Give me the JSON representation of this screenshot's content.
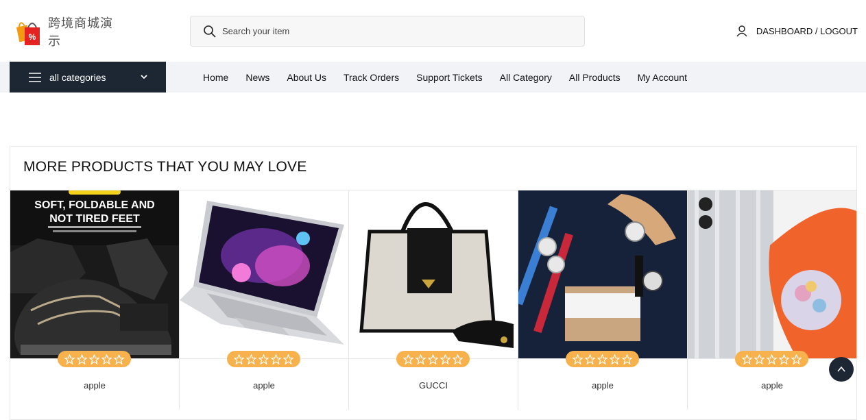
{
  "header": {
    "logo_text": "跨境商城演示",
    "logo_badge": "%",
    "search_placeholder": "Search your item",
    "account_label": "DASHBOARD / LOGOUT"
  },
  "nav": {
    "categories_label": "all categories",
    "items": [
      "Home",
      "News",
      "About Us",
      "Track Orders",
      "Support Tickets",
      "All Category",
      "All Products",
      "My Account"
    ]
  },
  "section": {
    "title": "MORE PRODUCTS THAT YOU MAY LOVE"
  },
  "products": [
    {
      "name": "apple",
      "image": "shoe",
      "banner_text_1": "SOFT, FOLDABLE AND",
      "banner_text_2": "NOT TIRED FEET",
      "rating": 0
    },
    {
      "name": "apple",
      "image": "laptop",
      "rating": 0
    },
    {
      "name": "GUCCI",
      "image": "handbag",
      "rating": 0
    },
    {
      "name": "apple",
      "image": "watches",
      "rating": 0
    },
    {
      "name": "apple",
      "image": "phone",
      "rating": 0
    }
  ],
  "colors": {
    "dark": "#1d2633",
    "accent": "#f7b14d",
    "nav_bg": "#f1f3f6"
  }
}
